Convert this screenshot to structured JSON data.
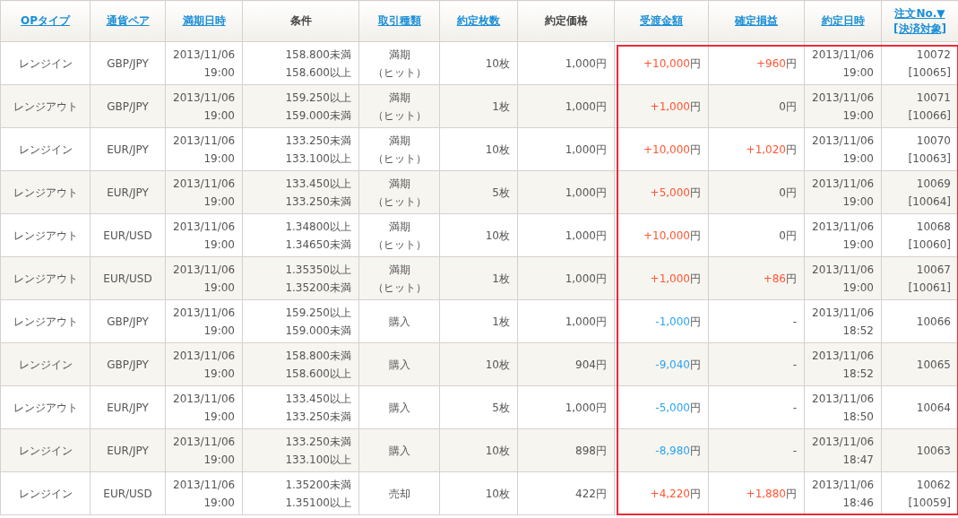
{
  "table": {
    "columns": [
      {
        "lines": [
          "OPタイプ"
        ],
        "link": true,
        "highlighted": false
      },
      {
        "lines": [
          "通貨ペア"
        ],
        "link": true,
        "highlighted": false
      },
      {
        "lines": [
          "満期日時"
        ],
        "link": true,
        "highlighted": false
      },
      {
        "lines": [
          "条件"
        ],
        "link": false,
        "highlighted": false
      },
      {
        "lines": [
          "取引種類"
        ],
        "link": true,
        "highlighted": false
      },
      {
        "lines": [
          "約定枚数"
        ],
        "link": true,
        "highlighted": false
      },
      {
        "lines": [
          "約定価格"
        ],
        "link": false,
        "highlighted": false
      },
      {
        "lines": [
          "受渡金額"
        ],
        "link": true,
        "highlighted": true
      },
      {
        "lines": [
          "確定損益"
        ],
        "link": true,
        "highlighted": true
      },
      {
        "lines": [
          "約定日時"
        ],
        "link": true,
        "highlighted": true
      },
      {
        "lines": [
          "注文No.▼",
          "[決済対象]"
        ],
        "link": true,
        "highlighted": true
      }
    ],
    "rows": [
      {
        "op_type": "レンジイン",
        "pair": "GBP/JPY",
        "expiry": [
          "2013/11/06",
          "19:00"
        ],
        "condition": [
          "158.800未満",
          "158.600以上"
        ],
        "trade_type": [
          "満期",
          "（ヒット）"
        ],
        "quantity": "10枚",
        "price": "1,000円",
        "settlement": {
          "value": "+10,000",
          "unit": "円",
          "kind": "gain"
        },
        "pnl": {
          "value": "+960",
          "unit": "円",
          "kind": "gain"
        },
        "executed": [
          "2013/11/06",
          "19:00"
        ],
        "order_no": [
          "10072",
          "[10065]"
        ]
      },
      {
        "op_type": "レンジアウト",
        "pair": "GBP/JPY",
        "expiry": [
          "2013/11/06",
          "19:00"
        ],
        "condition": [
          "159.250以上",
          "159.000未満"
        ],
        "trade_type": [
          "満期",
          "（ヒット）"
        ],
        "quantity": "1枚",
        "price": "1,000円",
        "settlement": {
          "value": "+1,000",
          "unit": "円",
          "kind": "gain"
        },
        "pnl": {
          "value": "0",
          "unit": "円",
          "kind": "none"
        },
        "executed": [
          "2013/11/06",
          "19:00"
        ],
        "order_no": [
          "10071",
          "[10066]"
        ]
      },
      {
        "op_type": "レンジイン",
        "pair": "EUR/JPY",
        "expiry": [
          "2013/11/06",
          "19:00"
        ],
        "condition": [
          "133.250未満",
          "133.100以上"
        ],
        "trade_type": [
          "満期",
          "（ヒット）"
        ],
        "quantity": "10枚",
        "price": "1,000円",
        "settlement": {
          "value": "+10,000",
          "unit": "円",
          "kind": "gain"
        },
        "pnl": {
          "value": "+1,020",
          "unit": "円",
          "kind": "gain"
        },
        "executed": [
          "2013/11/06",
          "19:00"
        ],
        "order_no": [
          "10070",
          "[10063]"
        ]
      },
      {
        "op_type": "レンジアウト",
        "pair": "EUR/JPY",
        "expiry": [
          "2013/11/06",
          "19:00"
        ],
        "condition": [
          "133.450以上",
          "133.250未満"
        ],
        "trade_type": [
          "満期",
          "（ヒット）"
        ],
        "quantity": "5枚",
        "price": "1,000円",
        "settlement": {
          "value": "+5,000",
          "unit": "円",
          "kind": "gain"
        },
        "pnl": {
          "value": "0",
          "unit": "円",
          "kind": "none"
        },
        "executed": [
          "2013/11/06",
          "19:00"
        ],
        "order_no": [
          "10069",
          "[10064]"
        ]
      },
      {
        "op_type": "レンジアウト",
        "pair": "EUR/USD",
        "expiry": [
          "2013/11/06",
          "19:00"
        ],
        "condition": [
          "1.34800以上",
          "1.34650未満"
        ],
        "trade_type": [
          "満期",
          "（ヒット）"
        ],
        "quantity": "10枚",
        "price": "1,000円",
        "settlement": {
          "value": "+10,000",
          "unit": "円",
          "kind": "gain"
        },
        "pnl": {
          "value": "0",
          "unit": "円",
          "kind": "none"
        },
        "executed": [
          "2013/11/06",
          "19:00"
        ],
        "order_no": [
          "10068",
          "[10060]"
        ]
      },
      {
        "op_type": "レンジアウト",
        "pair": "EUR/USD",
        "expiry": [
          "2013/11/06",
          "19:00"
        ],
        "condition": [
          "1.35350以上",
          "1.35200未満"
        ],
        "trade_type": [
          "満期",
          "（ヒット）"
        ],
        "quantity": "1枚",
        "price": "1,000円",
        "settlement": {
          "value": "+1,000",
          "unit": "円",
          "kind": "gain"
        },
        "pnl": {
          "value": "+86",
          "unit": "円",
          "kind": "gain"
        },
        "executed": [
          "2013/11/06",
          "19:00"
        ],
        "order_no": [
          "10067",
          "[10061]"
        ]
      },
      {
        "op_type": "レンジアウト",
        "pair": "GBP/JPY",
        "expiry": [
          "2013/11/06",
          "19:00"
        ],
        "condition": [
          "159.250以上",
          "159.000未満"
        ],
        "trade_type": [
          "購入"
        ],
        "quantity": "1枚",
        "price": "1,000円",
        "settlement": {
          "value": "-1,000",
          "unit": "円",
          "kind": "loss"
        },
        "pnl": {
          "value": "-",
          "kind": "none"
        },
        "executed": [
          "2013/11/06",
          "18:52"
        ],
        "order_no": [
          "10066"
        ]
      },
      {
        "op_type": "レンジイン",
        "pair": "GBP/JPY",
        "expiry": [
          "2013/11/06",
          "19:00"
        ],
        "condition": [
          "158.800未満",
          "158.600以上"
        ],
        "trade_type": [
          "購入"
        ],
        "quantity": "10枚",
        "price": "904円",
        "settlement": {
          "value": "-9,040",
          "unit": "円",
          "kind": "loss"
        },
        "pnl": {
          "value": "-",
          "kind": "none"
        },
        "executed": [
          "2013/11/06",
          "18:52"
        ],
        "order_no": [
          "10065"
        ]
      },
      {
        "op_type": "レンジアウト",
        "pair": "EUR/JPY",
        "expiry": [
          "2013/11/06",
          "19:00"
        ],
        "condition": [
          "133.450以上",
          "133.250未満"
        ],
        "trade_type": [
          "購入"
        ],
        "quantity": "5枚",
        "price": "1,000円",
        "settlement": {
          "value": "-5,000",
          "unit": "円",
          "kind": "loss"
        },
        "pnl": {
          "value": "-",
          "kind": "none"
        },
        "executed": [
          "2013/11/06",
          "18:50"
        ],
        "order_no": [
          "10064"
        ]
      },
      {
        "op_type": "レンジイン",
        "pair": "EUR/JPY",
        "expiry": [
          "2013/11/06",
          "19:00"
        ],
        "condition": [
          "133.250未満",
          "133.100以上"
        ],
        "trade_type": [
          "購入"
        ],
        "quantity": "10枚",
        "price": "898円",
        "settlement": {
          "value": "-8,980",
          "unit": "円",
          "kind": "loss"
        },
        "pnl": {
          "value": "-",
          "kind": "none"
        },
        "executed": [
          "2013/11/06",
          "18:47"
        ],
        "order_no": [
          "10063"
        ]
      },
      {
        "op_type": "レンジイン",
        "pair": "EUR/USD",
        "expiry": [
          "2013/11/06",
          "19:00"
        ],
        "condition": [
          "1.35200未満",
          "1.35100以上"
        ],
        "trade_type": [
          "売却"
        ],
        "quantity": "10枚",
        "price": "422円",
        "settlement": {
          "value": "+4,220",
          "unit": "円",
          "kind": "gain"
        },
        "pnl": {
          "value": "+1,880",
          "unit": "円",
          "kind": "gain"
        },
        "executed": [
          "2013/11/06",
          "18:46"
        ],
        "order_no": [
          "10062",
          "[10059]"
        ]
      }
    ]
  }
}
